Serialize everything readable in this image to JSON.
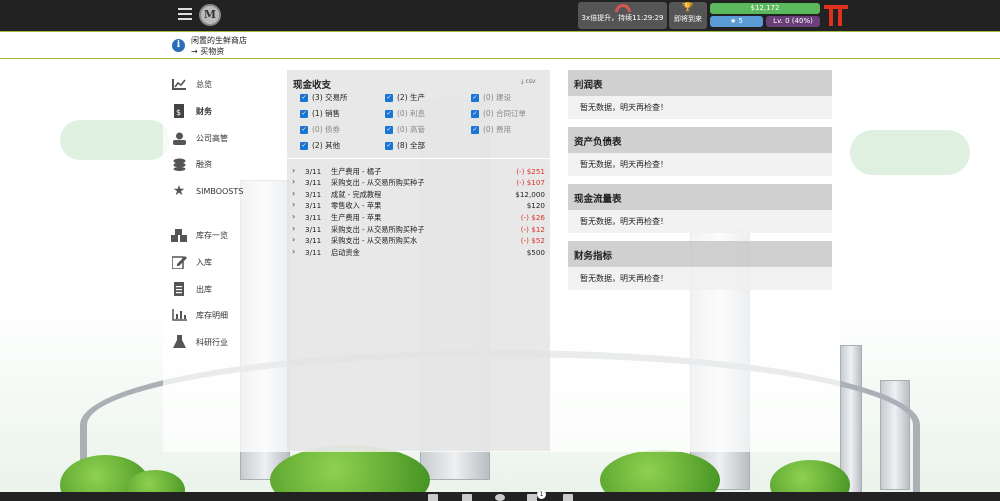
{
  "topbar": {
    "boost_text": "3x倍提升，持续11:29:29",
    "upcoming_label": "即将到来",
    "money": "$12,172",
    "rating": "5",
    "level": "Lv. 0 (40%)"
  },
  "notice": {
    "title": "闲置的生鲜商店",
    "action": "→ 买物资"
  },
  "sidebar": {
    "items": [
      {
        "label": "总览",
        "icon": "chart-icon"
      },
      {
        "label": "财务",
        "icon": "document-dollar-icon"
      },
      {
        "label": "公司高管",
        "icon": "executives-icon"
      },
      {
        "label": "融资",
        "icon": "coins-icon"
      },
      {
        "label": "SIMBOOSTS",
        "icon": "star-icon"
      },
      {
        "label": "库存一览",
        "icon": "boxes-icon"
      },
      {
        "label": "入库",
        "icon": "edit-icon"
      },
      {
        "label": "出库",
        "icon": "file-icon"
      },
      {
        "label": "库存明细",
        "icon": "bar-chart-icon"
      },
      {
        "label": "科研行业",
        "icon": "flask-icon"
      }
    ]
  },
  "cashflow": {
    "title": "现金收支",
    "csv_label": "csv",
    "filters": [
      {
        "label": "(3) 交易所",
        "checked": true
      },
      {
        "label": "(2) 生产",
        "checked": true
      },
      {
        "label": "(0) 建设",
        "checked": true
      },
      {
        "label": "(1) 销售",
        "checked": true
      },
      {
        "label": "(0) 利息",
        "checked": true
      },
      {
        "label": "(0) 合同订单",
        "checked": true
      },
      {
        "label": "(0) 债券",
        "checked": true
      },
      {
        "label": "(0) 高管",
        "checked": true
      },
      {
        "label": "(0) 费用",
        "checked": true
      },
      {
        "label": "(2) 其他",
        "checked": true
      },
      {
        "label": "(8) 全部",
        "checked": true
      }
    ],
    "rows": [
      {
        "date": "3/11",
        "desc": "生产费用 - 橘子",
        "amount": "(-) $251",
        "negative": true
      },
      {
        "date": "3/11",
        "desc": "采购支出 - 从交易所购买种子",
        "amount": "(-) $107",
        "negative": true
      },
      {
        "date": "3/11",
        "desc": "成就 - 完成教程",
        "amount": "$12,000",
        "negative": false
      },
      {
        "date": "3/11",
        "desc": "零售收入 - 苹果",
        "amount": "$120",
        "negative": false
      },
      {
        "date": "3/11",
        "desc": "生产费用 - 苹果",
        "amount": "(-) $26",
        "negative": true
      },
      {
        "date": "3/11",
        "desc": "采购支出 - 从交易所购买种子",
        "amount": "(-) $12",
        "negative": true
      },
      {
        "date": "3/11",
        "desc": "采购支出 - 从交易所购买水",
        "amount": "(-) $52",
        "negative": true
      },
      {
        "date": "3/11",
        "desc": "启动资金",
        "amount": "$500",
        "negative": false
      }
    ]
  },
  "reports": [
    {
      "title": "利润表",
      "body": "暂无数据，明天再检查！"
    },
    {
      "title": "资产负债表",
      "body": "暂无数据，明天再检查！"
    },
    {
      "title": "现金流量表",
      "body": "暂无数据，明天再检查！"
    },
    {
      "title": "财务指标",
      "body": "暂无数据，明天再检查！"
    }
  ],
  "bottombar": {
    "notification_count": "1"
  },
  "colors": {
    "accent": "#1976d2",
    "money": "#5cb85c",
    "negative": "#d9342b",
    "brand": "#e0301e"
  }
}
